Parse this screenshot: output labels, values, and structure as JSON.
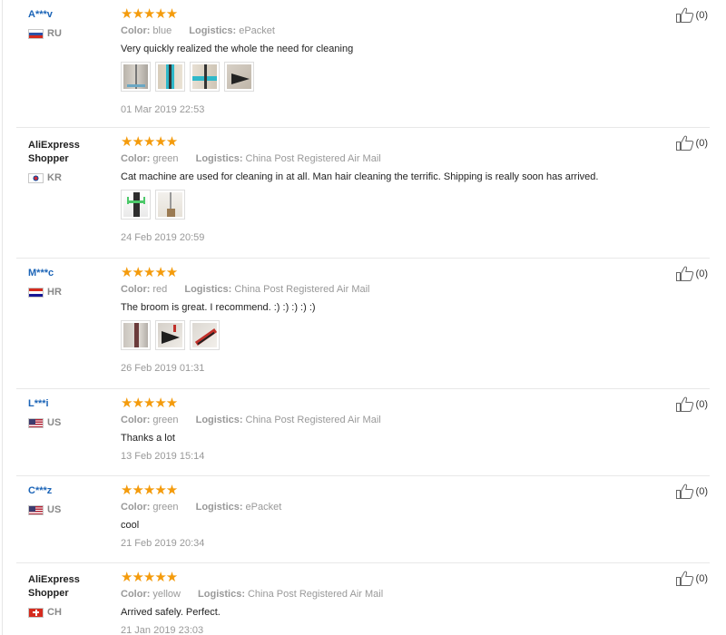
{
  "labels": {
    "color": "Color:",
    "logistics": "Logistics:"
  },
  "rating_stars": "★★★★★",
  "colors": {
    "accent_star": "#f49b0c",
    "link_blue": "#1b64b7"
  },
  "reviews": [
    {
      "user": "A***v",
      "country": "RU",
      "flag": "russia-flag",
      "color": "blue",
      "logistics": "ePacket",
      "text": "Very quickly realized the whole the need for cleaning",
      "photos": [
        "photo-1",
        "photo-2",
        "photo-3",
        "photo-4"
      ],
      "date": "01 Mar 2019 22:53",
      "helpful": "(0)"
    },
    {
      "user": "AliExpress Shopper",
      "country": "KR",
      "flag": "south-korea-flag",
      "color": "green",
      "logistics": "China Post Registered Air Mail",
      "text": "Cat machine are used for cleaning in at all. Man hair cleaning the terrific. Shipping is really soon has arrived.",
      "photos": [
        "photo-1",
        "photo-2"
      ],
      "date": "24 Feb 2019 20:59",
      "helpful": "(0)"
    },
    {
      "user": "M***c",
      "country": "HR",
      "flag": "croatia-flag",
      "color": "red",
      "logistics": "China Post Registered Air Mail",
      "text": "The broom is great. I recommend. :) :) :) :) :)",
      "photos": [
        "photo-1",
        "photo-2",
        "photo-3"
      ],
      "date": "26 Feb 2019 01:31",
      "helpful": "(0)"
    },
    {
      "user": "L***i",
      "country": "US",
      "flag": "usa-flag",
      "color": "green",
      "logistics": "China Post Registered Air Mail",
      "text": "Thanks a lot",
      "photos": [],
      "date": "13 Feb 2019 15:14",
      "helpful": "(0)"
    },
    {
      "user": "C***z",
      "country": "US",
      "flag": "usa-flag",
      "color": "green",
      "logistics": "ePacket",
      "text": "cool",
      "photos": [],
      "date": "21 Feb 2019 20:34",
      "helpful": "(0)"
    },
    {
      "user": "AliExpress Shopper",
      "country": "CH",
      "flag": "switzerland-flag",
      "color": "yellow",
      "logistics": "China Post Registered Air Mail",
      "text": "Arrived safely. Perfect.",
      "photos": [],
      "date": "21 Jan 2019 23:03",
      "helpful": "(0)"
    }
  ]
}
